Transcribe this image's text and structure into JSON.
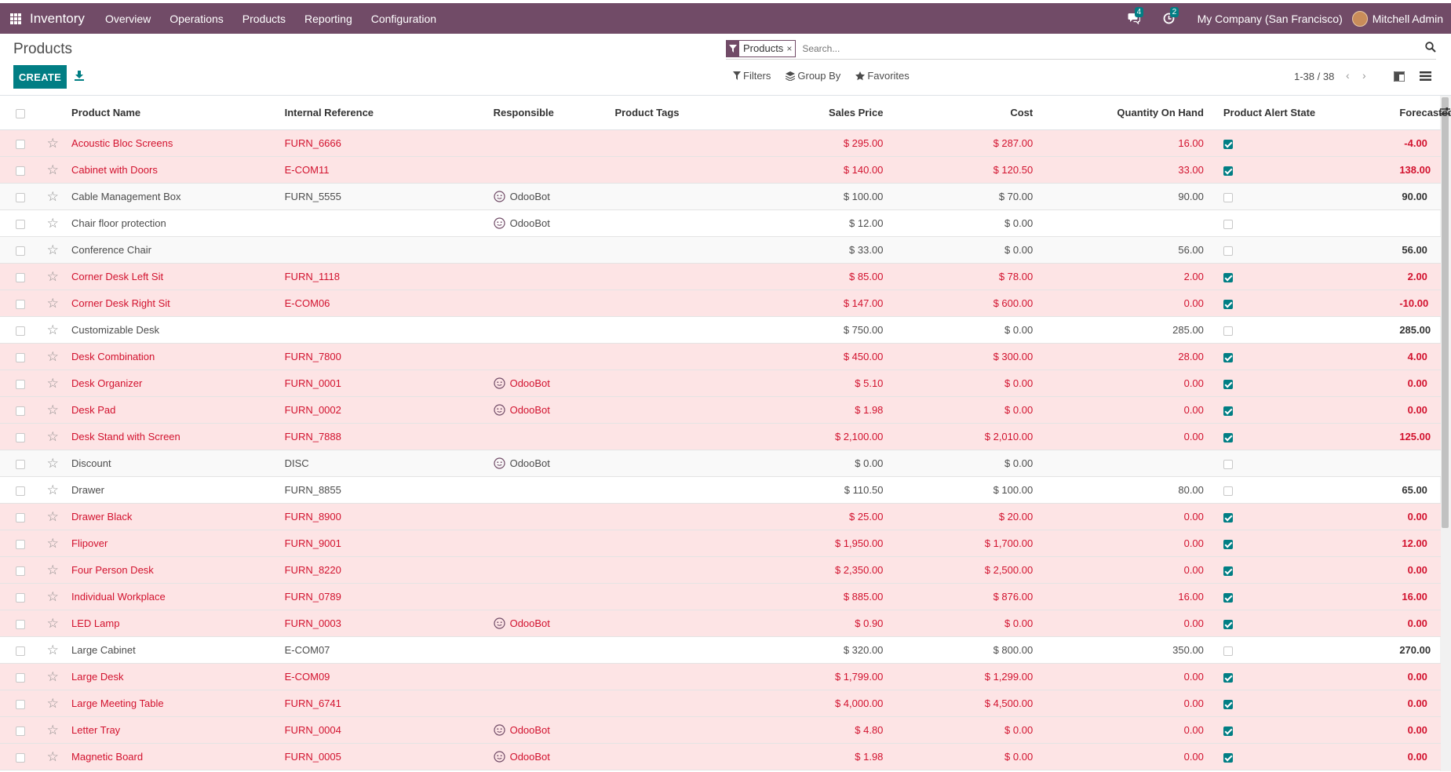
{
  "navbar": {
    "app_name": "Inventory",
    "menu": [
      "Overview",
      "Operations",
      "Products",
      "Reporting",
      "Configuration"
    ],
    "messages_count": "4",
    "activities_count": "2",
    "company": "My Company (San Francisco)",
    "user": "Mitchell Admin"
  },
  "control_panel": {
    "title": "Products",
    "create_label": "CREATE",
    "search_facet": "Products",
    "search_placeholder": "Search...",
    "filters_label": "Filters",
    "groupby_label": "Group By",
    "favorites_label": "Favorites",
    "pager_value": "1-38 / 38"
  },
  "columns": {
    "name": "Product Name",
    "ref": "Internal Reference",
    "responsible": "Responsible",
    "tags": "Product Tags",
    "price": "Sales Price",
    "cost": "Cost",
    "qty": "Quantity On Hand",
    "alert": "Product Alert State",
    "forecast": "Forecasted Quantity"
  },
  "rows": [
    {
      "name": "Acoustic Bloc Screens",
      "ref": "FURN_6666",
      "responsible": "",
      "price": "$ 295.00",
      "cost": "$ 287.00",
      "qty": "16.00",
      "alert": true,
      "forecast": "-4.00",
      "danger": true
    },
    {
      "name": "Cabinet with Doors",
      "ref": "E-COM11",
      "responsible": "",
      "price": "$ 140.00",
      "cost": "$ 120.50",
      "qty": "33.00",
      "alert": true,
      "forecast": "138.00",
      "danger": true
    },
    {
      "name": "Cable Management Box",
      "ref": "FURN_5555",
      "responsible": "OdooBot",
      "price": "$ 100.00",
      "cost": "$ 70.00",
      "qty": "90.00",
      "alert": false,
      "forecast": "90.00",
      "danger": false
    },
    {
      "name": "Chair floor protection",
      "ref": "",
      "responsible": "OdooBot",
      "price": "$ 12.00",
      "cost": "$ 0.00",
      "qty": "",
      "alert": false,
      "forecast": "",
      "danger": false
    },
    {
      "name": "Conference Chair",
      "ref": "",
      "responsible": "",
      "price": "$ 33.00",
      "cost": "$ 0.00",
      "qty": "56.00",
      "alert": false,
      "forecast": "56.00",
      "danger": false
    },
    {
      "name": "Corner Desk Left Sit",
      "ref": "FURN_1118",
      "responsible": "",
      "price": "$ 85.00",
      "cost": "$ 78.00",
      "qty": "2.00",
      "alert": true,
      "forecast": "2.00",
      "danger": true
    },
    {
      "name": "Corner Desk Right Sit",
      "ref": "E-COM06",
      "responsible": "",
      "price": "$ 147.00",
      "cost": "$ 600.00",
      "qty": "0.00",
      "alert": true,
      "forecast": "-10.00",
      "danger": true
    },
    {
      "name": "Customizable Desk",
      "ref": "",
      "responsible": "",
      "price": "$ 750.00",
      "cost": "$ 0.00",
      "qty": "285.00",
      "alert": false,
      "forecast": "285.00",
      "danger": false
    },
    {
      "name": "Desk Combination",
      "ref": "FURN_7800",
      "responsible": "",
      "price": "$ 450.00",
      "cost": "$ 300.00",
      "qty": "28.00",
      "alert": true,
      "forecast": "4.00",
      "danger": true
    },
    {
      "name": "Desk Organizer",
      "ref": "FURN_0001",
      "responsible": "OdooBot",
      "price": "$ 5.10",
      "cost": "$ 0.00",
      "qty": "0.00",
      "alert": true,
      "forecast": "0.00",
      "danger": true
    },
    {
      "name": "Desk Pad",
      "ref": "FURN_0002",
      "responsible": "OdooBot",
      "price": "$ 1.98",
      "cost": "$ 0.00",
      "qty": "0.00",
      "alert": true,
      "forecast": "0.00",
      "danger": true
    },
    {
      "name": "Desk Stand with Screen",
      "ref": "FURN_7888",
      "responsible": "",
      "price": "$ 2,100.00",
      "cost": "$ 2,010.00",
      "qty": "0.00",
      "alert": true,
      "forecast": "125.00",
      "danger": true
    },
    {
      "name": "Discount",
      "ref": "DISC",
      "responsible": "OdooBot",
      "price": "$ 0.00",
      "cost": "$ 0.00",
      "qty": "",
      "alert": false,
      "forecast": "",
      "danger": false
    },
    {
      "name": "Drawer",
      "ref": "FURN_8855",
      "responsible": "",
      "price": "$ 110.50",
      "cost": "$ 100.00",
      "qty": "80.00",
      "alert": false,
      "forecast": "65.00",
      "danger": false
    },
    {
      "name": "Drawer Black",
      "ref": "FURN_8900",
      "responsible": "",
      "price": "$ 25.00",
      "cost": "$ 20.00",
      "qty": "0.00",
      "alert": true,
      "forecast": "0.00",
      "danger": true
    },
    {
      "name": "Flipover",
      "ref": "FURN_9001",
      "responsible": "",
      "price": "$ 1,950.00",
      "cost": "$ 1,700.00",
      "qty": "0.00",
      "alert": true,
      "forecast": "12.00",
      "danger": true
    },
    {
      "name": "Four Person Desk",
      "ref": "FURN_8220",
      "responsible": "",
      "price": "$ 2,350.00",
      "cost": "$ 2,500.00",
      "qty": "0.00",
      "alert": true,
      "forecast": "0.00",
      "danger": true
    },
    {
      "name": "Individual Workplace",
      "ref": "FURN_0789",
      "responsible": "",
      "price": "$ 885.00",
      "cost": "$ 876.00",
      "qty": "16.00",
      "alert": true,
      "forecast": "16.00",
      "danger": true
    },
    {
      "name": "LED Lamp",
      "ref": "FURN_0003",
      "responsible": "OdooBot",
      "price": "$ 0.90",
      "cost": "$ 0.00",
      "qty": "0.00",
      "alert": true,
      "forecast": "0.00",
      "danger": true
    },
    {
      "name": "Large Cabinet",
      "ref": "E-COM07",
      "responsible": "",
      "price": "$ 320.00",
      "cost": "$ 800.00",
      "qty": "350.00",
      "alert": false,
      "forecast": "270.00",
      "danger": false
    },
    {
      "name": "Large Desk",
      "ref": "E-COM09",
      "responsible": "",
      "price": "$ 1,799.00",
      "cost": "$ 1,299.00",
      "qty": "0.00",
      "alert": true,
      "forecast": "0.00",
      "danger": true
    },
    {
      "name": "Large Meeting Table",
      "ref": "FURN_6741",
      "responsible": "",
      "price": "$ 4,000.00",
      "cost": "$ 4,500.00",
      "qty": "0.00",
      "alert": true,
      "forecast": "0.00",
      "danger": true
    },
    {
      "name": "Letter Tray",
      "ref": "FURN_0004",
      "responsible": "OdooBot",
      "price": "$ 4.80",
      "cost": "$ 0.00",
      "qty": "0.00",
      "alert": true,
      "forecast": "0.00",
      "danger": true
    },
    {
      "name": "Magnetic Board",
      "ref": "FURN_0005",
      "responsible": "OdooBot",
      "price": "$ 1.98",
      "cost": "$ 0.00",
      "qty": "0.00",
      "alert": true,
      "forecast": "0.00",
      "danger": true
    }
  ],
  "colors": {
    "brand": "#714b67",
    "primary": "#017e84",
    "danger_text": "#d2122e",
    "danger_bg": "#fde4e5"
  },
  "icons": {
    "apps": "apps-grid-icon",
    "messages": "chat-icon",
    "activities": "clock-icon",
    "download": "download-icon",
    "filter": "filter-icon",
    "groupby": "layers-icon",
    "favorites": "star-icon",
    "search": "search-icon",
    "kanban": "kanban-view-icon",
    "list": "list-view-icon",
    "optional_columns": "sliders-icon",
    "favorite_row": "star-outline-icon",
    "responsible_avatar": "bot-face-icon"
  }
}
